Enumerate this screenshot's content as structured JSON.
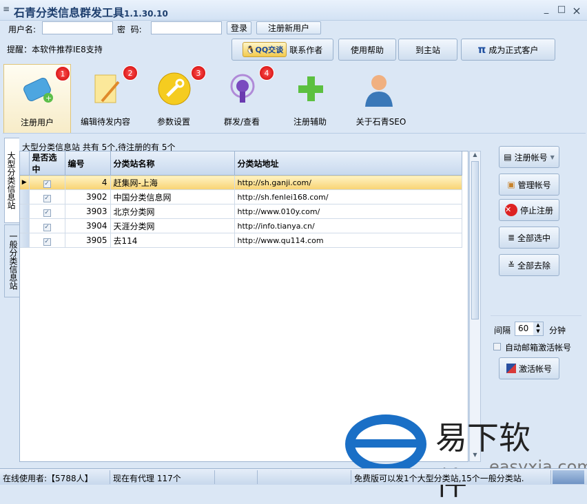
{
  "window": {
    "menu_icon": "≡",
    "title": "石青分类信息群发工具",
    "version": "1.1.30.10",
    "min": "_",
    "max": "□",
    "close": "×"
  },
  "login": {
    "username_label": "用户名:",
    "username_value": "",
    "password_label": "密  码:",
    "password_value": "",
    "login_btn": "登录",
    "register_btn": "注册新用户"
  },
  "hint": "提醒：本软件推荐IE8支持",
  "top_buttons": {
    "qq": "QQ交谈",
    "contact": "联系作者",
    "help": "使用帮助",
    "site": "到主站",
    "vip_icon": "π",
    "vip": "成为正式客户"
  },
  "toolbar": [
    {
      "label": "注册用户",
      "badge": "1"
    },
    {
      "label": "编辑待发内容",
      "badge": "2"
    },
    {
      "label": "参数设置",
      "badge": "3"
    },
    {
      "label": "群发/查看",
      "badge": "4"
    },
    {
      "label": "注册辅助"
    },
    {
      "label": "关于石青SEO"
    }
  ],
  "side_tabs": [
    "大型分类信息站",
    "一般分类信息站"
  ],
  "group_title": "大型分类信息站 共有 5个,待注册的有 5个",
  "grid": {
    "columns": [
      "是否选中",
      "编号",
      "分类站名称",
      "分类站地址"
    ],
    "rows": [
      {
        "checked": true,
        "id": "4",
        "name": "赶集网-上海",
        "url": "http://sh.ganji.com/"
      },
      {
        "checked": true,
        "id": "3902",
        "name": "中国分类信息网",
        "url": "http://sh.fenlei168.com/"
      },
      {
        "checked": true,
        "id": "3903",
        "name": "北京分类网",
        "url": "http://www.010y.com/"
      },
      {
        "checked": true,
        "id": "3904",
        "name": "天涯分类网",
        "url": "http://info.tianya.cn/"
      },
      {
        "checked": true,
        "id": "3905",
        "name": "去114",
        "url": "http://www.qu114.com"
      }
    ]
  },
  "right_panel": {
    "register": "注册帐号",
    "manage": "管理帐号",
    "stop": "停止注册",
    "select_all": "全部选中",
    "clear_all": "全部去除",
    "interval_label": "间隔",
    "interval_value": "60",
    "interval_unit": "分钟",
    "auto_activate": "自动邮箱激活帐号",
    "auto_activate_checked": false,
    "activate": "激活帐号"
  },
  "status": {
    "online": "在线使用者:【5788人】",
    "proxy": "现在有代理 117个",
    "free": "免费版可以发1个大型分类站,15个一般分类站."
  },
  "watermark": {
    "text": "易下软件",
    "url": "easyxia.com"
  }
}
